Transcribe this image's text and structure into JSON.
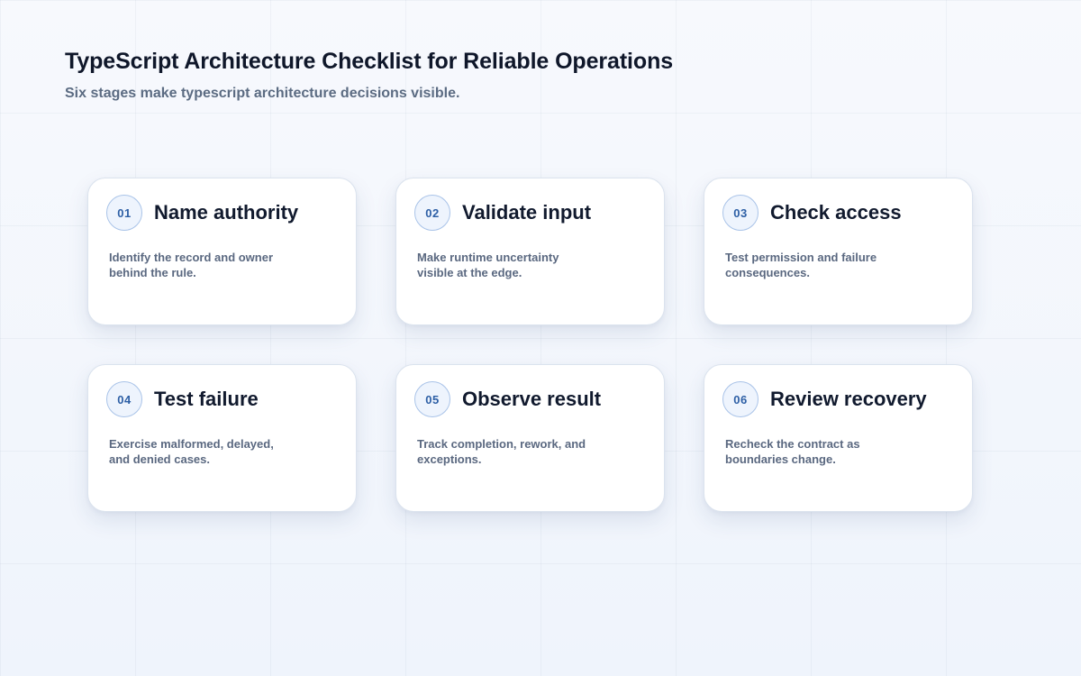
{
  "header": {
    "title": "TypeScript Architecture Checklist for Reliable Operations",
    "subtitle": "Six stages make typescript architecture decisions visible."
  },
  "steps": [
    {
      "number": "01",
      "title": "Name authority",
      "description": "Identify the record and owner behind the rule."
    },
    {
      "number": "02",
      "title": "Validate input",
      "description": "Make runtime uncertainty visible at the edge."
    },
    {
      "number": "03",
      "title": "Check access",
      "description": "Test permission and failure consequences."
    },
    {
      "number": "04",
      "title": "Test failure",
      "description": "Exercise malformed, delayed, and denied cases."
    },
    {
      "number": "05",
      "title": "Observe result",
      "description": "Track completion, rework, and exceptions."
    },
    {
      "number": "06",
      "title": "Review recovery",
      "description": "Recheck the contract as boundaries change."
    }
  ],
  "colors": {
    "accent": "#2d5fa5",
    "badge_border": "#a9c3e8",
    "title_text": "#0f172a",
    "muted_text": "#5b6b82",
    "card_background": "#ffffff"
  }
}
